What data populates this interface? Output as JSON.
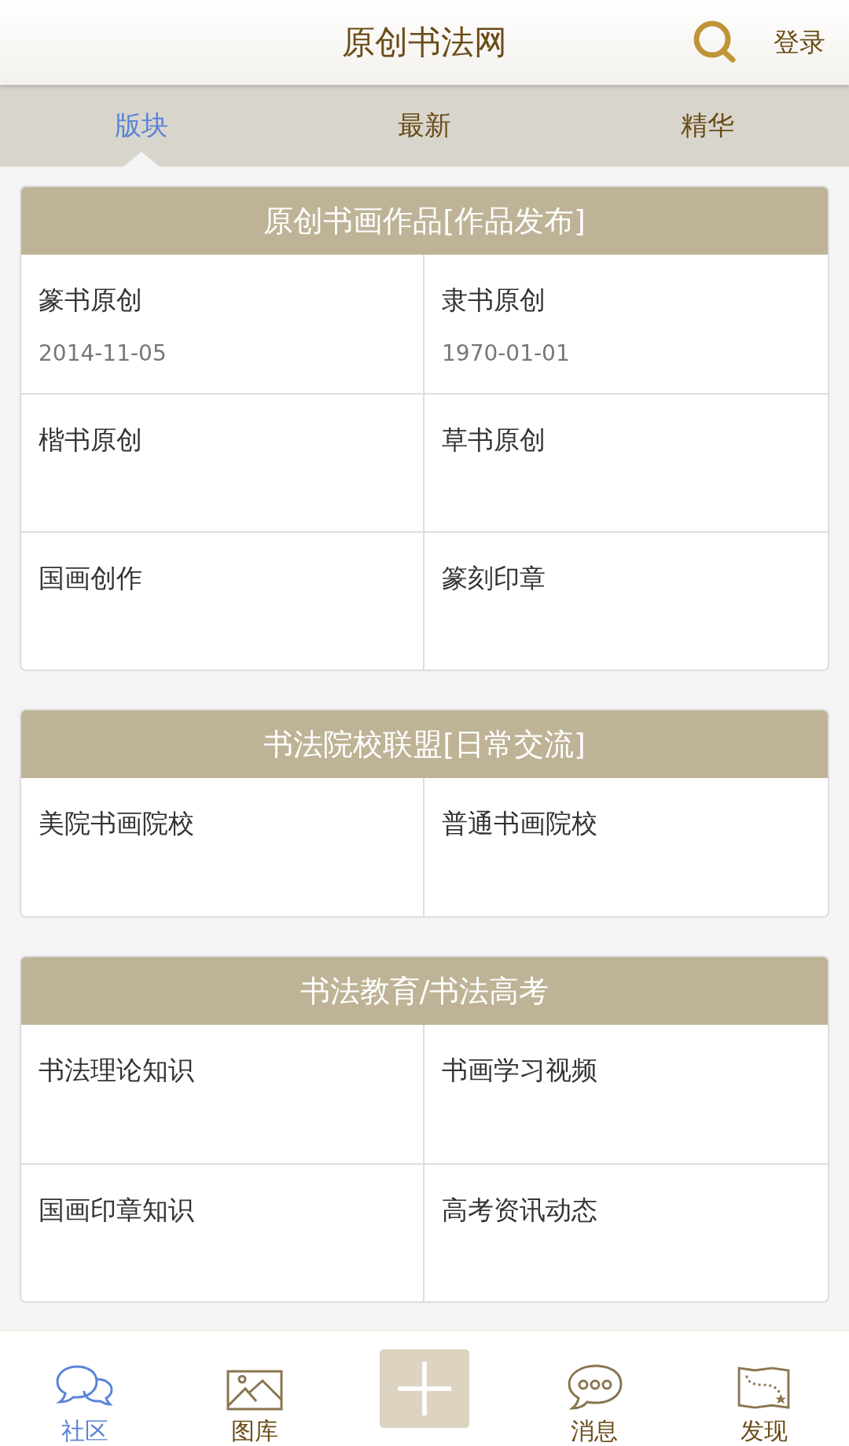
{
  "header": {
    "title": "原创书法网",
    "login": "登录"
  },
  "tabs": [
    {
      "label": "版块",
      "selected": true
    },
    {
      "label": "最新",
      "selected": false
    },
    {
      "label": "精华",
      "selected": false
    }
  ],
  "sections": [
    {
      "title": "原创书画作品[作品发布]",
      "forums": [
        {
          "name": "篆书原创",
          "date": "2014-11-05"
        },
        {
          "name": "隶书原创",
          "date": "1970-01-01"
        },
        {
          "name": "楷书原创"
        },
        {
          "name": "草书原创"
        },
        {
          "name": "国画创作"
        },
        {
          "name": "篆刻印章"
        }
      ]
    },
    {
      "title": "书法院校联盟[日常交流]",
      "forums": [
        {
          "name": "美院书画院校"
        },
        {
          "name": "普通书画院校"
        }
      ]
    },
    {
      "title": "书法教育/书法高考",
      "forums": [
        {
          "name": "书法理论知识"
        },
        {
          "name": "书画学习视频"
        },
        {
          "name": "国画印章知识"
        },
        {
          "name": "高考资讯动态"
        }
      ]
    }
  ],
  "bottom_nav": [
    {
      "kind": "chat",
      "label": "社区",
      "selected": true
    },
    {
      "kind": "gallery",
      "label": "图库",
      "selected": false
    },
    {
      "kind": "add"
    },
    {
      "kind": "message",
      "label": "消息",
      "selected": false
    },
    {
      "kind": "map",
      "label": "发现",
      "selected": false
    }
  ]
}
